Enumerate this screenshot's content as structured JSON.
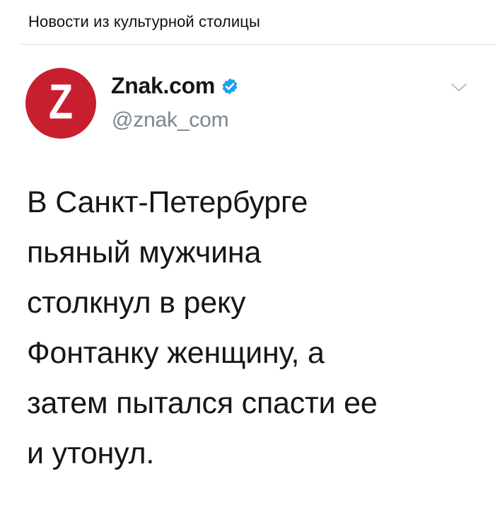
{
  "caption": "Новости из культурной столицы",
  "tweet": {
    "avatar_letter": "Z",
    "name": "Znak.com",
    "handle": "@znak_com",
    "verified": true,
    "lines": [
      "В Санкт-Петербурге",
      "пьяный мужчина",
      "столкнул в реку",
      "Фонтанку женщину, а",
      "затем пытался спасти ее",
      "и утонул."
    ]
  },
  "colors": {
    "avatar_bg": "#c81f2f",
    "verified": "#1da1f2",
    "handle": "#7b8791"
  },
  "icons": {
    "verified": "verified-badge-icon",
    "menu": "chevron-down-icon"
  }
}
